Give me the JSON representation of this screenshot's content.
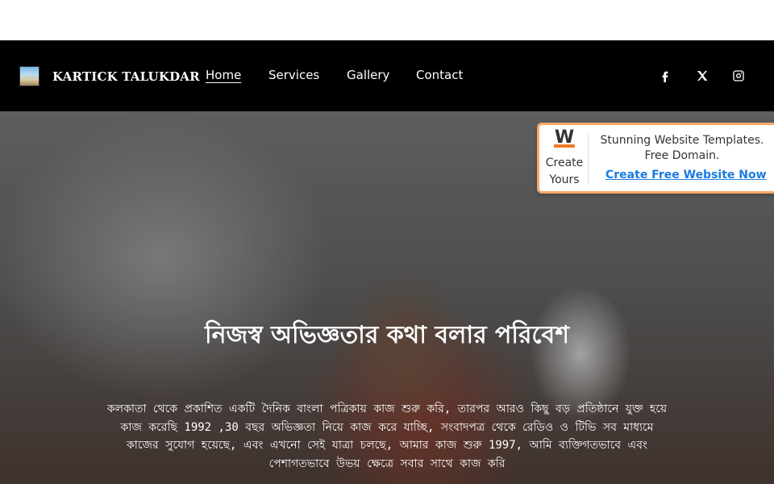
{
  "header": {
    "brand": "KARTICK TALUKDAR",
    "nav": [
      {
        "label": "Home",
        "active": true
      },
      {
        "label": "Services",
        "active": false
      },
      {
        "label": "Gallery",
        "active": false
      },
      {
        "label": "Contact",
        "active": false
      }
    ],
    "social": [
      "facebook-icon",
      "x-icon",
      "instagram-icon"
    ]
  },
  "promo": {
    "logo_letter": "W",
    "create_yours": "Create Yours",
    "tagline": "Stunning Website Templates. Free Domain.",
    "cta": "Create Free Website Now",
    "accent": "#f07a2a",
    "border": "#f5a86a",
    "link_color": "#1a7be0"
  },
  "hero": {
    "title": "নিজস্ব অভিজ্ঞতার কথা বলার পরিবেশ",
    "body": "কলকাতা থেকে প্রকাশিত একটি দৈনিক বাংলা পত্রিকায় কাজ শুরু করি, তারপর আরও কিছু বড় প্রতিষ্ঠানে যুক্ত হয়ে কাজ করেছি 1992 ,30 বছর অভিজ্ঞতা নিয়ে কাজ করে যাচ্ছি, সংবাদপত্র থেকে রেডিও ও টিভি সব মাধ্যমে কাজের সুযোগ হয়েছে, এবং এখনো সেই যাত্রা চলছে, আমার কাজ শুরু 1997, আমি ব্যক্তিগতভাবে এবং পেশাগতভাবে উভয় ক্ষেত্রে সবার সাথে কাজ করি"
  },
  "colors": {
    "navbar": "#000000",
    "text_light": "#ffffff"
  }
}
